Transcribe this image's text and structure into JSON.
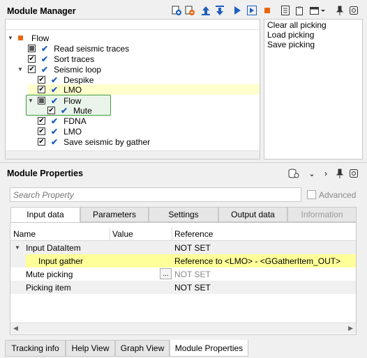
{
  "module_manager": {
    "title": "Module Manager",
    "tree": [
      {
        "label": "Flow",
        "depth": 0,
        "expand": "open",
        "check": "none",
        "icon": "flow-square"
      },
      {
        "label": "Read seismic traces",
        "depth": 1,
        "check": "partial"
      },
      {
        "label": "Sort traces",
        "depth": 1,
        "check": "checked"
      },
      {
        "label": "Seismic loop",
        "depth": 1,
        "expand": "open",
        "check": "checked"
      },
      {
        "label": "Despike",
        "depth": 2,
        "check": "checked"
      },
      {
        "label": "LMO",
        "depth": 2,
        "check": "checked",
        "highlight": "yellow"
      },
      {
        "label": "Flow",
        "depth": 2,
        "expand": "open",
        "check": "partial",
        "selected": true
      },
      {
        "label": "Mute",
        "depth": 3,
        "check": "checked",
        "selected": true
      },
      {
        "label": "FDNA",
        "depth": 2,
        "check": "checked"
      },
      {
        "label": "LMO",
        "depth": 2,
        "check": "checked"
      },
      {
        "label": "Save seismic by gather",
        "depth": 2,
        "check": "checked"
      }
    ],
    "side_actions": [
      "Clear all picking",
      "Load picking",
      "Save picking"
    ]
  },
  "module_properties": {
    "title": "Module Properties",
    "search_placeholder": "Search Property",
    "advanced_label": "Advanced",
    "tabs": [
      "Input data",
      "Parameters",
      "Settings",
      "Output data",
      "Information"
    ],
    "active_tab": 0,
    "columns": [
      "Name",
      "Value",
      "Reference"
    ],
    "rows": [
      {
        "name": "Input DataItem",
        "value": "",
        "reference": "NOT SET",
        "group": true
      },
      {
        "name": "Input gather",
        "value": "",
        "reference": "Reference to <LMO> - <GGatherItem_OUT>",
        "highlight": true
      },
      {
        "name": "Mute picking",
        "value": "...",
        "reference": "NOT SET",
        "ref_gray": true
      },
      {
        "name": "Picking item",
        "value": "",
        "reference": "NOT SET"
      }
    ]
  },
  "bottom_tabs": [
    "Tracking info",
    "Help View",
    "Graph View",
    "Module Properties"
  ],
  "bottom_active": 3,
  "colors": {
    "accent": "#1f5fbf",
    "highlight": "#ffff99",
    "selected_border": "#3c9c3c",
    "stop": "#e8660c"
  }
}
